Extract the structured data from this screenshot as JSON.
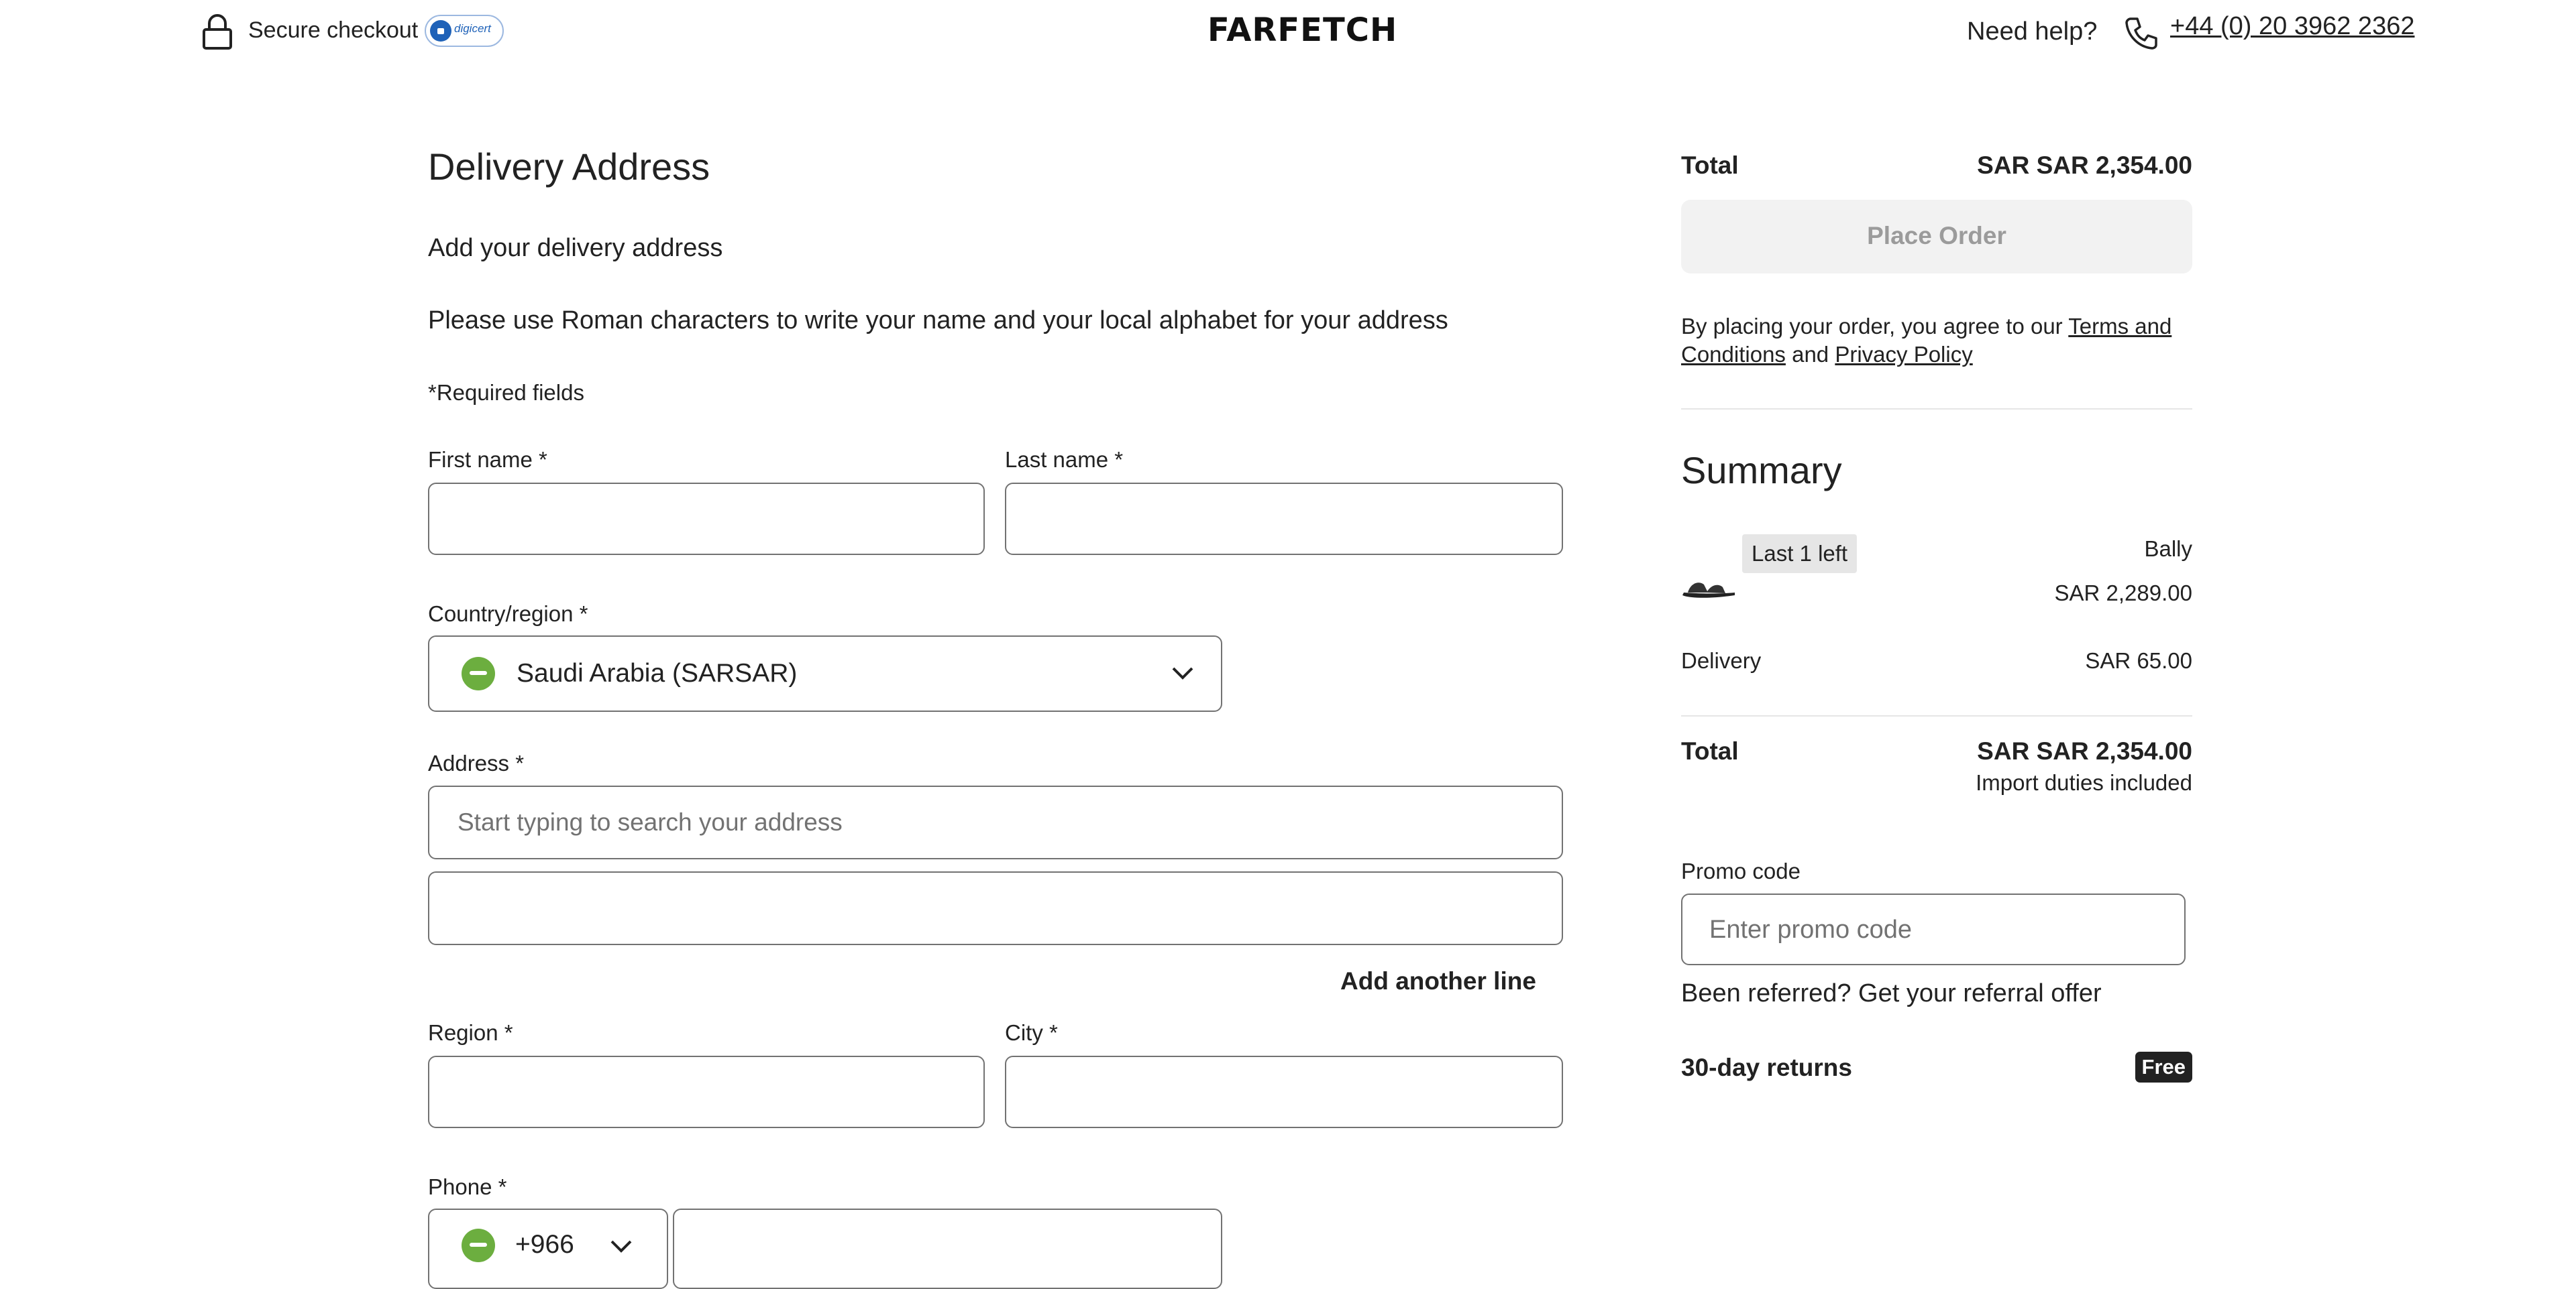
{
  "header": {
    "secure_checkout": "Secure checkout",
    "badge_text": "digicert",
    "logo": "FARFETCH",
    "need_help": "Need help?",
    "phone": "+44 (0) 20 3962 2362"
  },
  "form": {
    "title": "Delivery Address",
    "subtitle": "Add your delivery address",
    "instructions": "Please use Roman characters to write your name and your local alphabet for your address",
    "required_note": "*Required fields",
    "first_name_label": "First name *",
    "last_name_label": "Last name *",
    "country_label": "Country/region *",
    "country_value": "Saudi Arabia (SARSAR)",
    "address_label": "Address *",
    "address_placeholder": "Start typing to search your address",
    "add_line": "Add another line",
    "region_label": "Region *",
    "city_label": "City *",
    "phone_label": "Phone *",
    "phone_code": "+966"
  },
  "order": {
    "total_label": "Total",
    "total_value": "SAR SAR 2,354.00",
    "place_order": "Place Order",
    "legal_prefix": "By placing your order, you agree to our ",
    "terms_part1": "Terms and",
    "terms_part2": "Conditions",
    "and": " and ",
    "privacy": "Privacy Policy"
  },
  "summary": {
    "title": "Summary",
    "item": {
      "stock_badge": "Last 1 left",
      "brand": "Bally",
      "price": "SAR 2,289.00"
    },
    "delivery_label": "Delivery",
    "delivery_value": "SAR 65.00",
    "total_label": "Total",
    "total_value": "SAR SAR 2,354.00",
    "duties": "Import duties included",
    "promo_label": "Promo code",
    "promo_placeholder": "Enter promo code",
    "referral": "Been referred? Get your referral offer",
    "returns_label": "30-day returns",
    "returns_badge": "Free"
  },
  "colors": {
    "text": "#222222",
    "border": "#727272",
    "disabled_bg": "#f2f2f2",
    "disabled_text": "#9b9b9b",
    "flag_green": "#6cae3f",
    "digicert_blue": "#1f62b8"
  },
  "icons": [
    "lock-icon",
    "digicert-seal",
    "phone-icon",
    "flag-icon",
    "chevron-down-icon",
    "sandal-thumbnail"
  ]
}
